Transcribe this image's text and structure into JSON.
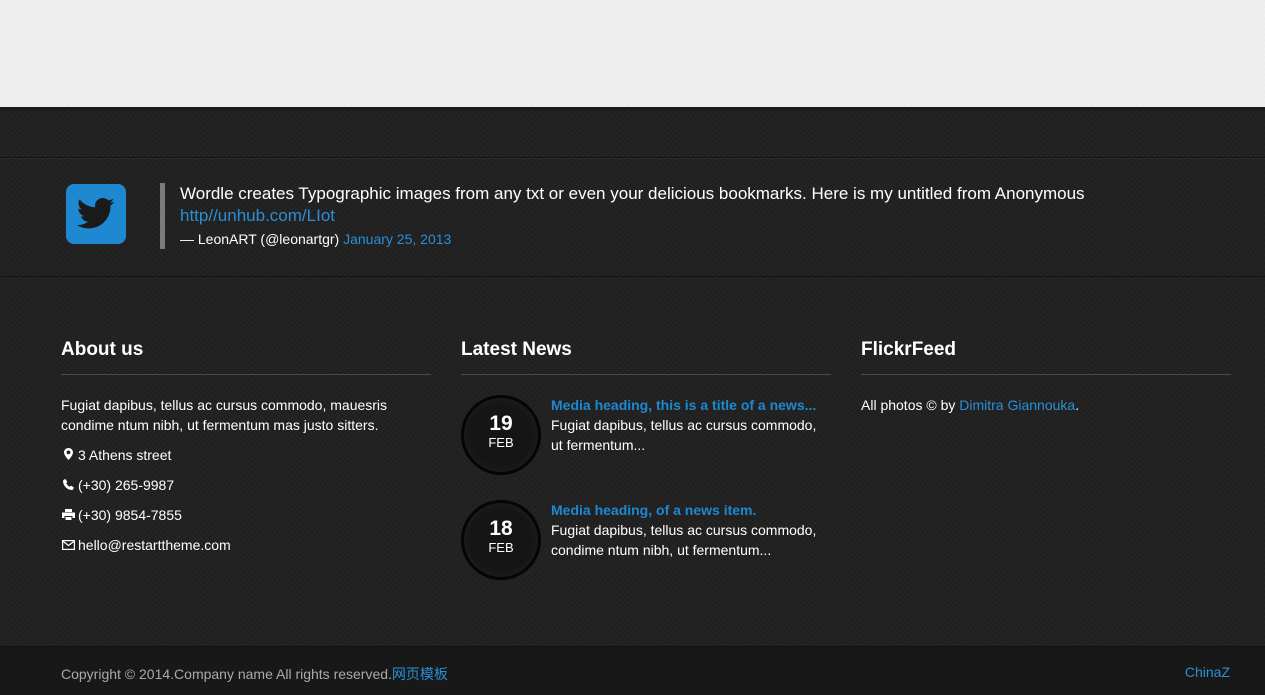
{
  "tweet": {
    "text": "Wordle creates Typographic images from any txt or even your delicious bookmarks. Here is my untitled from Anonymous",
    "link": "http//unhub.com/LIot",
    "author": "— LeonART (@leonartgr)",
    "date": "January 25, 2013"
  },
  "about": {
    "title": "About us",
    "text": "Fugiat dapibus, tellus ac cursus commodo, mauesris condime ntum nibh, ut fermentum mas justo sitters.",
    "address": "3 Athens street",
    "phone": "(+30) 265-9987",
    "fax": "(+30) 9854-7855",
    "email": "hello@restarttheme.com"
  },
  "news": {
    "title": "Latest News",
    "items": [
      {
        "day": "19",
        "month": "FEB",
        "heading": "Media heading, this is a title of a news...",
        "desc": "Fugiat dapibus, tellus ac cursus commodo, ut fermentum..."
      },
      {
        "day": "18",
        "month": "FEB",
        "heading": "Media heading, of a news item.",
        "desc": "Fugiat dapibus, tellus ac cursus commodo, condime ntum nibh, ut fermentum..."
      }
    ]
  },
  "flickr": {
    "title": "FlickrFeed",
    "prefix": "All photos © by",
    "author": "Dimitra Giannouka",
    "suffix": "."
  },
  "footer": {
    "copyright": "Copyright © 2014.Company name All rights reserved.",
    "link": "网页模板",
    "right_link": "ChinaZ"
  },
  "colors": {
    "accent": "#2a8fd6",
    "twitter": "#1e88d0"
  }
}
